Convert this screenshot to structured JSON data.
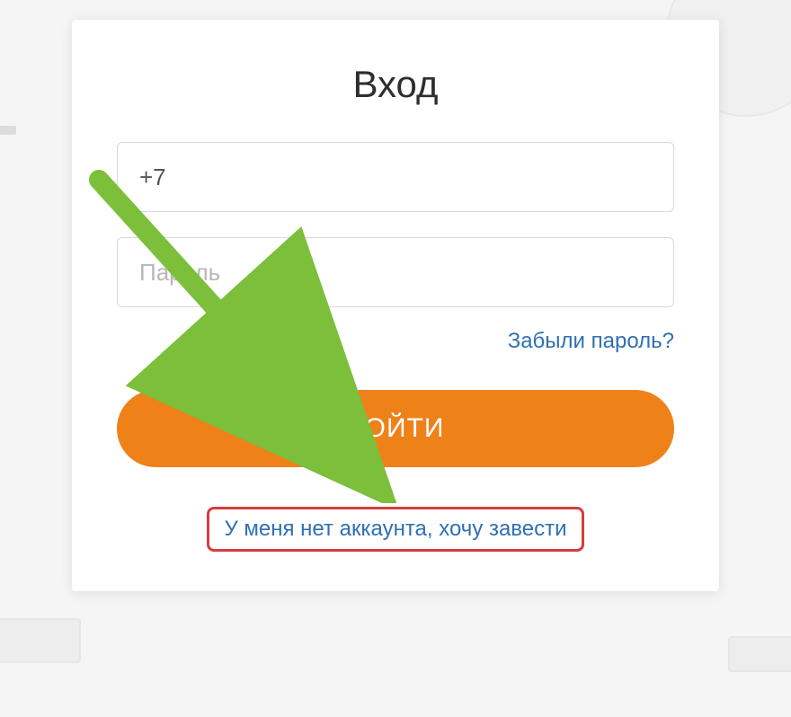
{
  "title": "Вход",
  "phone": {
    "value": "+7"
  },
  "password": {
    "placeholder": "Пароль"
  },
  "forgot_password": "Забыли пароль?",
  "login_button": "ВОЙТИ",
  "signup_link": "У меня нет аккаунта, хочу завести"
}
